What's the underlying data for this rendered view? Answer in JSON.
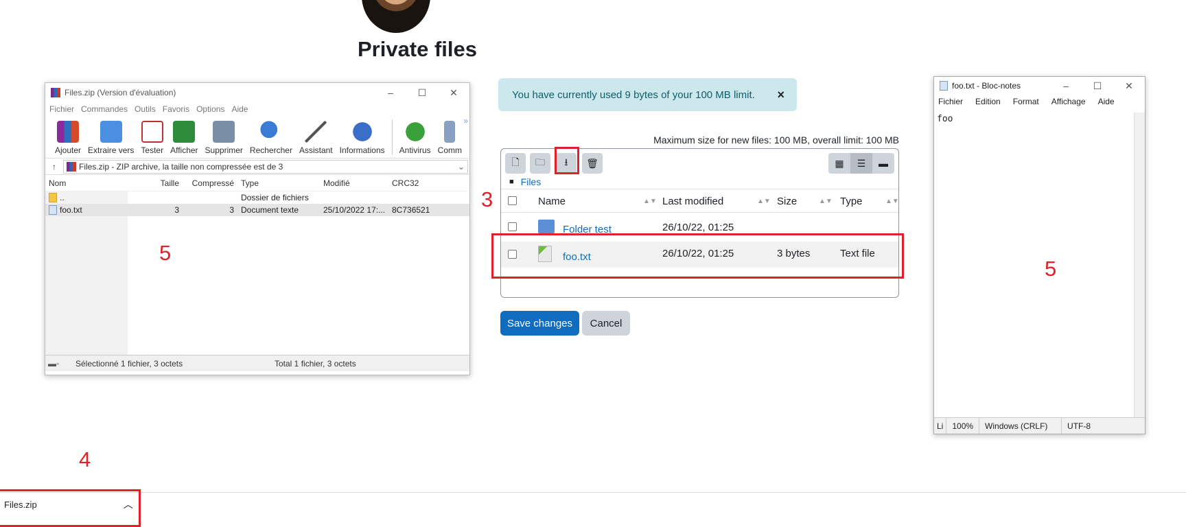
{
  "page": {
    "title": "Private files"
  },
  "winrar": {
    "title": "Files.zip (Version d'évaluation)",
    "window_controls": [
      "–",
      "☐",
      "✕"
    ],
    "menu": [
      "Fichier",
      "Commandes",
      "Outils",
      "Favoris",
      "Options",
      "Aide"
    ],
    "toolbar": [
      "Ajouter",
      "Extraire vers",
      "Tester",
      "Afficher",
      "Supprimer",
      "Rechercher",
      "Assistant",
      "Informations",
      "Antivirus",
      "Comm"
    ],
    "address": "Files.zip - ZIP archive, la taille non compressée est de 3",
    "columns": [
      "Nom",
      "Taille",
      "Compressé",
      "Type",
      "Modifié",
      "CRC32"
    ],
    "rows": [
      {
        "name": "..",
        "size": "",
        "packed": "",
        "type": "Dossier de fichiers",
        "modified": "",
        "crc": ""
      },
      {
        "name": "foo.txt",
        "size": "3",
        "packed": "3",
        "type": "Document texte",
        "modified": "25/10/2022 17:...",
        "crc": "8C736521"
      }
    ],
    "status_left": "Sélectionné 1 fichier, 3 octets",
    "status_right": "Total 1 fichier, 3 octets"
  },
  "annotations": {
    "n3": "3",
    "n4": "4",
    "n5a": "5",
    "n5b": "5"
  },
  "filemanager": {
    "alert": "You have currently used 9 bytes of your 100 MB limit.",
    "alert_close": "×",
    "max_size": "Maximum size for new files: 100 MB, overall limit: 100 MB",
    "breadcrumb": "Files",
    "columns": {
      "name": "Name",
      "modified": "Last modified",
      "size": "Size",
      "type": "Type"
    },
    "rows": [
      {
        "name": "Folder test",
        "modified": "26/10/22, 01:25",
        "size": "",
        "type": ""
      },
      {
        "name": "foo.txt",
        "modified": "26/10/22, 01:25",
        "size": "3 bytes",
        "type": "Text file"
      }
    ],
    "save": "Save changes",
    "cancel": "Cancel"
  },
  "notepad": {
    "title": "foo.txt - Bloc-notes",
    "menu": [
      "Fichier",
      "Edition",
      "Format",
      "Affichage",
      "Aide"
    ],
    "content": "foo",
    "status": [
      "Li",
      "100%",
      "Windows (CRLF)",
      "UTF-8"
    ]
  },
  "download": {
    "file": "Files.zip"
  }
}
